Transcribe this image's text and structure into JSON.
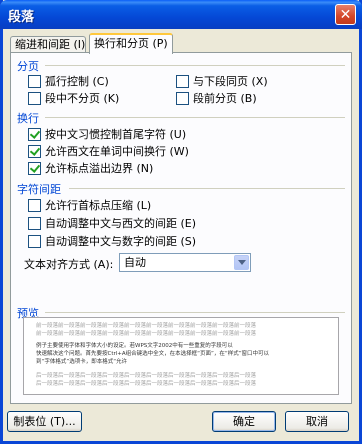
{
  "window": {
    "title": "段落"
  },
  "tabs": [
    {
      "label": "缩进和间距 (I)"
    },
    {
      "label": "换行和分页 (P)"
    }
  ],
  "sections": {
    "pagination": {
      "title": "分页",
      "items": [
        {
          "label": "孤行控制 (C)",
          "checked": false
        },
        {
          "label": "与下段同页 (X)",
          "checked": false
        },
        {
          "label": "段中不分页 (K)",
          "checked": false
        },
        {
          "label": "段前分页 (B)",
          "checked": false
        }
      ]
    },
    "line_break": {
      "title": "换行",
      "items": [
        {
          "label": "按中文习惯控制首尾字符 (U)",
          "checked": true
        },
        {
          "label": "允许西文在单词中间换行 (W)",
          "checked": true
        },
        {
          "label": "允许标点溢出边界 (N)",
          "checked": true
        }
      ]
    },
    "char_spacing": {
      "title": "字符间距",
      "items": [
        {
          "label": "允许行首标点压缩 (L)",
          "checked": false
        },
        {
          "label": "自动调整中文与西文的间距 (E)",
          "checked": false
        },
        {
          "label": "自动调整中文与数字的间距 (S)",
          "checked": false
        }
      ],
      "alignment_label": "文本对齐方式 (A):",
      "alignment_value": "自动"
    },
    "preview": {
      "title": "预览",
      "prev_text": "前一段落前一段落前一段落前一段落前一段落前一段落前一段落前一段落前一段落前一段落",
      "prev_text2": "前一段落前一段落前一段落前一段落前一段落前一段落前一段落前一段落前一段落前一段落",
      "body1": "例子主要使用字体和字体大小的设定。若WPS文字2002中有一些重复的字段可以",
      "body2": "快速解决这个问题。首先要按Ctrl+A组合键选中全文，在本选择框“页面”，在“样式”窗口中可以",
      "body3": "到“字体格式”选项卡，即本格式“允许",
      "next_text": "后一段落后一段落后一段落后一段落后一段落后一段落后一段落后一段落后一段落后一段落"
    }
  },
  "buttons": {
    "tabs": "制表位 (T)...",
    "ok": "确定",
    "cancel": "取消"
  }
}
